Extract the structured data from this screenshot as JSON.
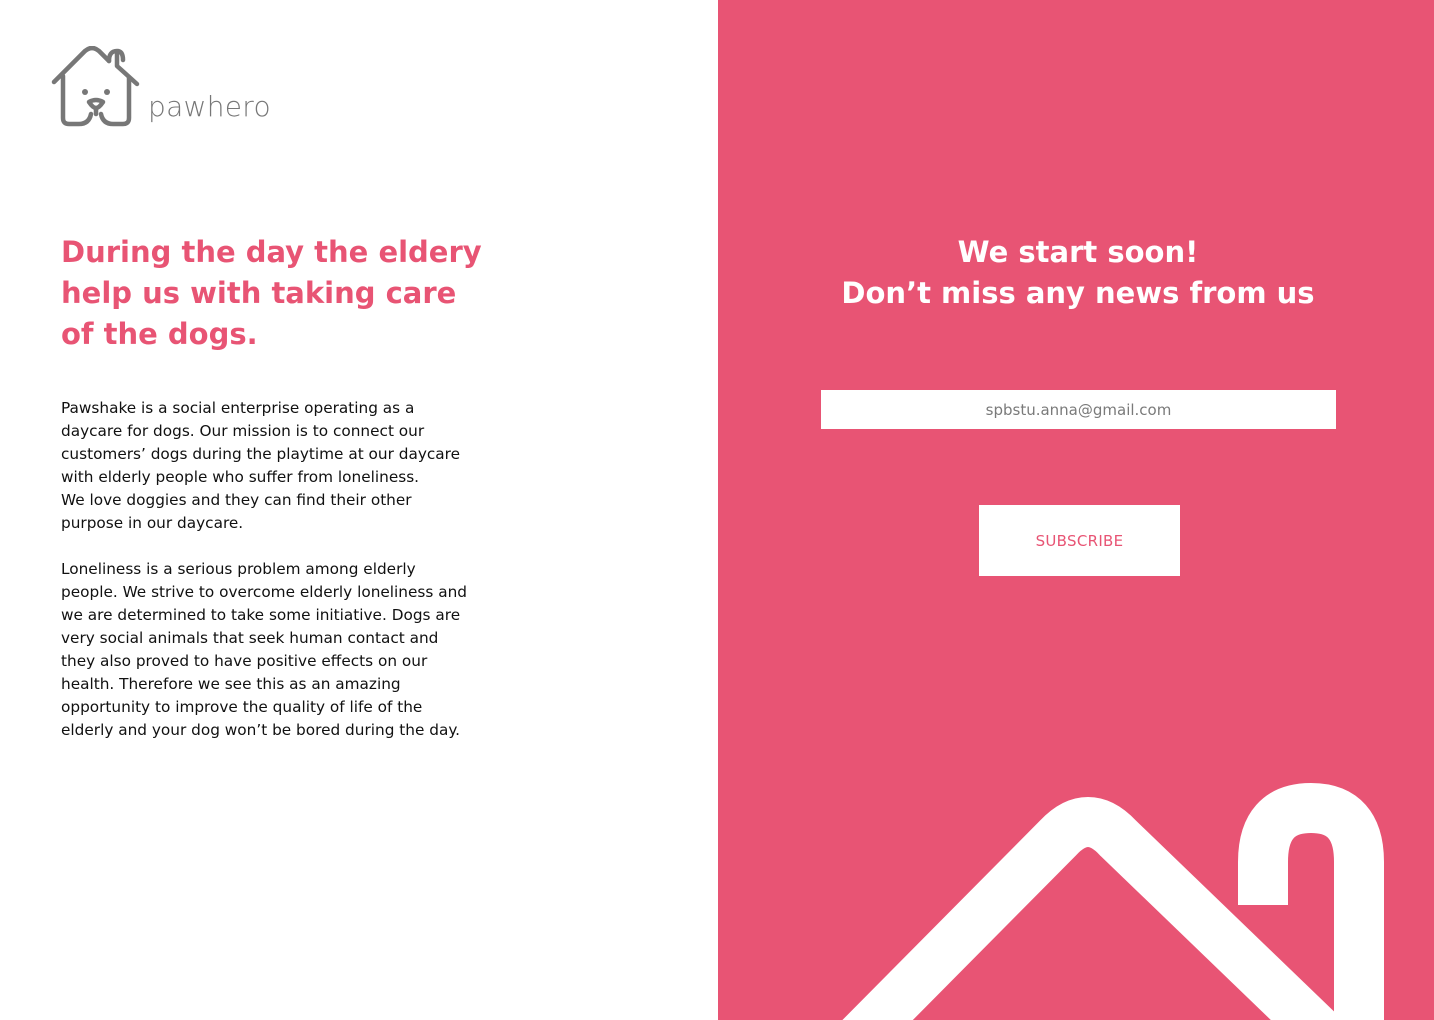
{
  "brand": {
    "name": "pawhero",
    "logo_icon": "dog-house-icon",
    "accent_color": "#e85474",
    "logo_color": "#777777"
  },
  "left": {
    "headline": "During the day the eldery help us with taking care of the dogs.",
    "paragraph_1": "Pawshake is a social enterprise operating as a\ndaycare for dogs. Our mission is to connect our\ncustomers’ dogs during the playtime at our daycare\nwith elderly people who suffer from loneliness.\nWe love doggies and they can find their other\npurpose in our daycare.",
    "paragraph_2": "Loneliness is a serious problem among elderly\npeople. We strive to overcome elderly loneliness and\nwe are determined to take some initiative. Dogs are\nvery social animals that seek human contact and\nthey also proved to have positive effects on our\nhealth. Therefore we see this as an amazing\nopportunity to improve the quality of life of the\nelderly and your dog won’t be bored during the day."
  },
  "right": {
    "title": "We start soon!\nDon’t miss any news from us",
    "email_value": "spbstu.anna@gmail.com",
    "subscribe_label": "SUBSCRIBE",
    "background_color": "#e85474",
    "decoration_icon": "house-outline-icon"
  }
}
